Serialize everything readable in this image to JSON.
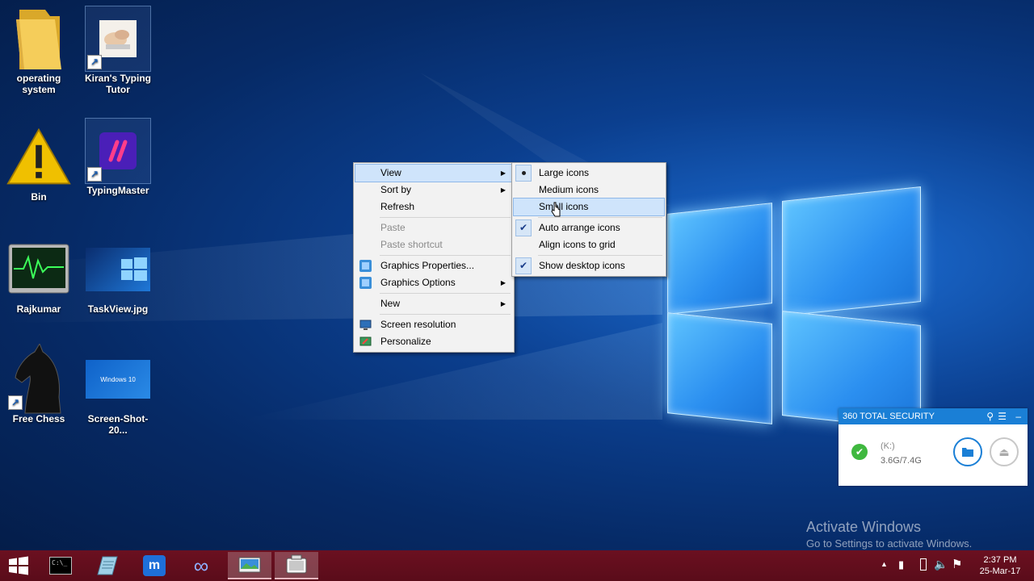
{
  "desktop_icons": [
    {
      "label": "operating system"
    },
    {
      "label": "Kiran's Typing Tutor"
    },
    {
      "label": "Bin"
    },
    {
      "label": "TypingMaster"
    },
    {
      "label": "Rajkumar"
    },
    {
      "label": "TaskView.jpg"
    },
    {
      "label": "Free Chess"
    },
    {
      "label": "Screen-Shot-20..."
    }
  ],
  "screenshot_thumb_text": "Windows 10",
  "context_menu": {
    "items": {
      "view": "View",
      "sort_by": "Sort by",
      "refresh": "Refresh",
      "paste": "Paste",
      "paste_shortcut": "Paste shortcut",
      "graphics_properties": "Graphics Properties...",
      "graphics_options": "Graphics Options",
      "new": "New",
      "screen_resolution": "Screen resolution",
      "personalize": "Personalize"
    }
  },
  "view_submenu": {
    "items": {
      "large_icons": "Large icons",
      "medium_icons": "Medium icons",
      "small_icons": "Small icons",
      "auto_arrange": "Auto arrange icons",
      "align_grid": "Align icons to grid",
      "show_desktop_icons": "Show desktop icons"
    }
  },
  "security_widget": {
    "title": "360 TOTAL SECURITY",
    "drive": "(K:)",
    "usage": "3.6G/7.4G"
  },
  "watermark": {
    "line1": "Activate Windows",
    "line2": "Go to Settings to activate Windows."
  },
  "tray": {
    "time": "2:37 PM",
    "date": "25-Mar-17"
  },
  "colors": {
    "taskbar": "#5a0c1a",
    "menu_highlight": "#cfe4fb",
    "security_header": "#1a7fd6"
  }
}
